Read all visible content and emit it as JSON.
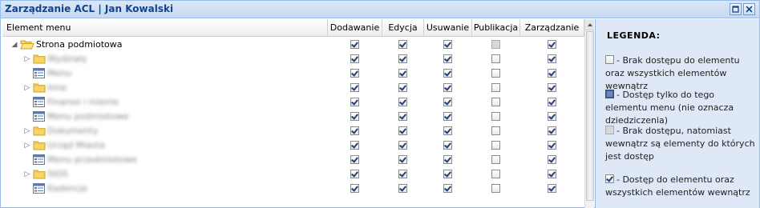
{
  "window": {
    "title": "Zarządzanie ACL | Jan Kowalski",
    "tools": [
      "maximize-icon",
      "close-icon"
    ]
  },
  "grid": {
    "columns": [
      "Element menu",
      "Dodawanie",
      "Edycja",
      "Usuwanie",
      "Publikacja",
      "Zarządzanie"
    ],
    "rows": [
      {
        "label": "Strona podmiotowa",
        "icon": "folder-open-icon",
        "expander": "expanded",
        "blurred": false,
        "perms": [
          "checked",
          "checked",
          "checked",
          "grayed",
          "checked"
        ]
      },
      {
        "label": "Wydziały",
        "icon": "folder-icon",
        "expander": "collapsed",
        "blurred": true,
        "perms": [
          "checked",
          "checked",
          "checked",
          "unchecked",
          "checked"
        ]
      },
      {
        "label": "Menu",
        "icon": "menu-page-icon",
        "expander": "none",
        "blurred": true,
        "perms": [
          "checked",
          "checked",
          "checked",
          "unchecked",
          "checked"
        ]
      },
      {
        "label": "Inne",
        "icon": "folder-icon",
        "expander": "collapsed",
        "blurred": true,
        "perms": [
          "checked",
          "checked",
          "checked",
          "unchecked",
          "checked"
        ]
      },
      {
        "label": "Finanse i mienie",
        "icon": "menu-page-icon",
        "expander": "none",
        "blurred": true,
        "perms": [
          "checked",
          "checked",
          "checked",
          "unchecked",
          "checked"
        ]
      },
      {
        "label": "Menu podmiotowe",
        "icon": "menu-page-icon",
        "expander": "none",
        "blurred": true,
        "perms": [
          "checked",
          "checked",
          "checked",
          "unchecked",
          "checked"
        ]
      },
      {
        "label": "Dokumenty",
        "icon": "folder-icon",
        "expander": "collapsed",
        "blurred": true,
        "perms": [
          "checked",
          "checked",
          "checked",
          "unchecked",
          "checked"
        ]
      },
      {
        "label": "Urząd Miasta",
        "icon": "folder-icon",
        "expander": "collapsed",
        "blurred": true,
        "perms": [
          "checked",
          "checked",
          "checked",
          "unchecked",
          "checked"
        ]
      },
      {
        "label": "Menu przedmiotowe",
        "icon": "menu-page-icon",
        "expander": "none",
        "blurred": true,
        "perms": [
          "checked",
          "checked",
          "checked",
          "unchecked",
          "checked"
        ]
      },
      {
        "label": "SIOS",
        "icon": "folder-icon",
        "expander": "collapsed",
        "blurred": true,
        "perms": [
          "checked",
          "checked",
          "checked",
          "unchecked",
          "checked"
        ]
      },
      {
        "label": "Kadencje",
        "icon": "menu-page-icon",
        "expander": "none",
        "blurred": true,
        "perms": [
          "checked",
          "checked",
          "checked",
          "unchecked",
          "checked"
        ]
      }
    ]
  },
  "legend": {
    "title": "LEGENDA:",
    "items": [
      {
        "state": "unchecked",
        "text": "- Brak dostępu do elementu oraz wszystkich elementów wewnątrz"
      },
      {
        "state": "full",
        "text": "- Dostęp tylko do tego elementu menu (nie oznacza dziedziczenia)"
      },
      {
        "state": "grayed",
        "text": "- Brak dostępu, natomiast wewnątrz są elementy do których jest dostęp"
      },
      {
        "state": "checked",
        "text": "- Dostęp do elementu oraz wszystkich elementów wewnątrz"
      }
    ]
  }
}
